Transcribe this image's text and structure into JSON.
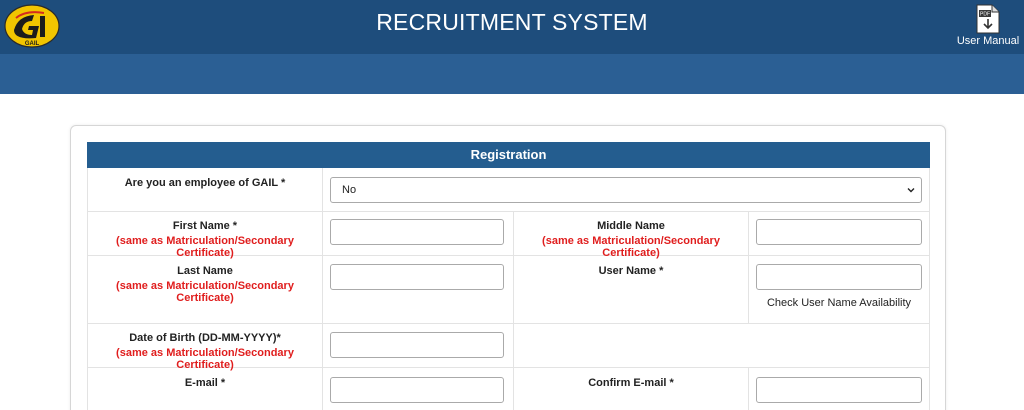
{
  "header": {
    "title": "RECRUITMENT SYSTEM",
    "logo_text": "GAIL",
    "manual_label": "User Manual",
    "manual_icon": "pdf-file-icon"
  },
  "colors": {
    "topbar": "#1e4d7c",
    "subbar": "#2b5f94",
    "section_header": "#245d8f",
    "required_note": "#e01e1e",
    "logo_yellow": "#f2c500"
  },
  "form": {
    "section_title": "Registration",
    "employee": {
      "label": "Are you an employee of GAIL *",
      "value": "No"
    },
    "first_name": {
      "label": "First Name *",
      "note": "(same as Matriculation/Secondary Certificate)"
    },
    "middle_name": {
      "label": "Middle Name",
      "note": "(same as Matriculation/Secondary Certificate)"
    },
    "last_name": {
      "label": "Last Name",
      "note": "(same as Matriculation/Secondary Certificate)"
    },
    "user_name": {
      "label": "User Name *",
      "check_label": "Check User Name Availability"
    },
    "dob": {
      "label": "Date of Birth (DD-MM-YYYY)*",
      "note": "(same as Matriculation/Secondary Certificate)"
    },
    "email": {
      "label": "E-mail *"
    },
    "confirm_email": {
      "label": "Confirm E-mail *"
    }
  }
}
